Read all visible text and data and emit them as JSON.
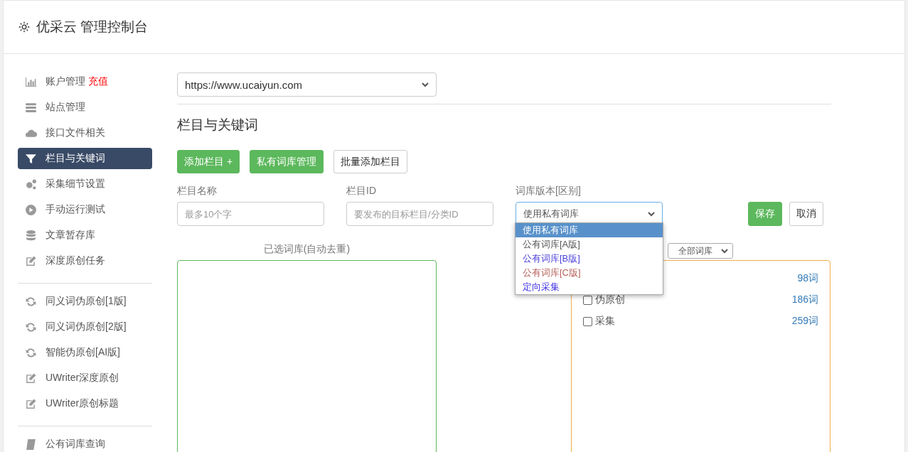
{
  "header": {
    "title": "优采云 管理控制台"
  },
  "sidebar": {
    "groups": [
      {
        "items": [
          {
            "label": "账户管理",
            "badge": "充值",
            "selected": false
          },
          {
            "label": "站点管理",
            "selected": false
          },
          {
            "label": "接口文件相关",
            "selected": false
          },
          {
            "label": "栏目与关键词",
            "selected": true
          },
          {
            "label": "采集细节设置",
            "selected": false
          },
          {
            "label": "手动运行测试",
            "selected": false
          },
          {
            "label": "文章暂存库",
            "selected": false
          },
          {
            "label": "深度原创任务",
            "selected": false
          }
        ]
      },
      {
        "items": [
          {
            "label": "同义词伪原创[1版]",
            "selected": false
          },
          {
            "label": "同义词伪原创[2版]",
            "selected": false
          },
          {
            "label": "智能伪原创[AI版]",
            "selected": false
          },
          {
            "label": "UWriter深度原创",
            "selected": false
          },
          {
            "label": "UWriter原创标题",
            "selected": false
          }
        ]
      },
      {
        "items": [
          {
            "label": "公有词库查询",
            "selected": false
          }
        ]
      }
    ]
  },
  "site_select": {
    "value": "https://www.ucaiyun.com"
  },
  "section_title": "栏目与关键词",
  "actions": [
    {
      "label": "添加栏目 +",
      "kind": "primary"
    },
    {
      "label": "私有词库管理",
      "kind": "primary"
    },
    {
      "label": "批量添加栏目",
      "kind": "default"
    }
  ],
  "form": {
    "fields": [
      {
        "label": "栏目名称",
        "kind": "input",
        "placeholder": "最多10个字"
      },
      {
        "label": "栏目ID",
        "kind": "input",
        "placeholder": "要发布的目标栏目/分类ID"
      },
      {
        "label": "词库版本[区别]",
        "kind": "select",
        "value": "使用私有词库"
      }
    ],
    "save": "保存",
    "cancel": "取消"
  },
  "dropdown": {
    "options": [
      {
        "label": "使用私有词库",
        "selected": true
      },
      {
        "label": "公有词库[A版]",
        "selected": false
      },
      {
        "label": "公有词库[B版]",
        "selected": false,
        "color": "#4a3fd8"
      },
      {
        "label": "公有词库[C版]",
        "selected": false,
        "color": "#b5605a"
      },
      {
        "label": "定向采集",
        "selected": false,
        "color": "#3c2fe0"
      }
    ]
  },
  "selected_words": {
    "label": "已选词库(自动去重)"
  },
  "library_filter": {
    "value": "全部词库"
  },
  "libraries": [
    {
      "count": "98词"
    },
    {
      "label": "伪原创",
      "count": "186词",
      "checked": false
    },
    {
      "label": "采集",
      "count": "259词",
      "checked": false
    }
  ]
}
